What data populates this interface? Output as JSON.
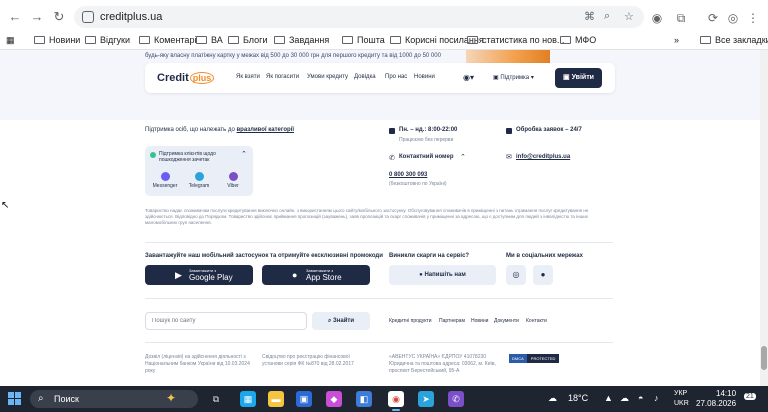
{
  "browser": {
    "url": "creditplus.ua",
    "bookmarks": [
      "Новини",
      "Відгуки",
      "Коментарі",
      "ВА",
      "Блоги",
      "Завдання",
      "Пошта",
      "Корисні посилання",
      "статистика по нов...",
      "МФО"
    ],
    "all_bookmarks": "Все закладки"
  },
  "promo": {
    "text": "будь-яку власну платіжну картку у межах від 500 до 30 000 грн для першого кредиту та від 1000 до 50 000"
  },
  "header": {
    "logo_text": "Credit",
    "logo_plus": "plus",
    "nav": [
      "Як взяти",
      "Як погасити",
      "Умови кредиту",
      "Довідка",
      "Про нас",
      "Новини"
    ],
    "support_label": "Підтримка",
    "login_label": "Увійти"
  },
  "footer": {
    "support_intro": "Підтримка осіб, що належать до",
    "support_link": "вразливої категорії",
    "schedule": "Пн. – нд.: 8:00-22:00",
    "schedule_note": "Працюємо без перерви",
    "processing": "Обробка заявок – 24/7",
    "contact_label": "Контактний номер",
    "phone": "0 800 300 093",
    "phone_note": "(безкоштовно по Україні)",
    "email": "info@creditplus.ua",
    "chat_title": "Підтримка клієнтів щодо пошкодження зачетак",
    "messengers": [
      "Messenger",
      "Telegram",
      "Viber"
    ],
    "disclaimer": "Товариство надає споживачам послуги кредитування виключно онлайн, з використанням цього сайту/мобільного застосунку. Обслуговування споживачів в приміщенні з питань отримання послуг кредитування не здійснюється. Відповідно до Порядком. Товариство здійснює приймання пропозицій (зауважень), заяв пропозицій та скарг споживачів у приміщенні за адресою, що є доступним для людей з інвалідністю та інших маломобільних груп населення.",
    "app_promo": "Завантажуйте наш мобільний застосунок та отримуйте ексклюзивні промокоди",
    "google_small": "Завантажити з",
    "google_big": "Google Play",
    "apple_small": "Завантажити з",
    "apple_big": "App Store",
    "complaint_title": "Виникли скарги на сервіс?",
    "complaint_btn": "Напишіть нам",
    "social_title": "Ми в соціальних мережах",
    "search_placeholder": "Пошук по сайту",
    "search_btn": "Знайти",
    "links": [
      "Кредитні продукти",
      "Партнерам",
      "Новини",
      "Документи",
      "Контакти"
    ],
    "legal1_line1": "Дозвіл (ліцензія) на здійснення діяльності з",
    "legal1_line2": "Національним банком України від 10.03.2024",
    "legal1_line3": "року",
    "legal2_line1": "Свідоцтво про реєстрацію фінансової",
    "legal2_line2": "установи серія ФК №870 від 28.02.2017",
    "legal3_line1": "«АВЕНТУС УКРАЇНА» ЄДРПОУ 41078230",
    "legal3_line2": "Юридична та поштова адреса: 03062, м. Київ,",
    "legal3_line3": "проспект Берестейський, 95-А",
    "dmca_a": "DMCA",
    "dmca_b": "PROTECTED"
  },
  "taskbar": {
    "search_label": "Поиск",
    "weather": "18°C",
    "lang_top": "УКР",
    "lang_bottom": "UKR",
    "time": "14:10",
    "date": "27.08.2026",
    "notif_count": "21"
  }
}
